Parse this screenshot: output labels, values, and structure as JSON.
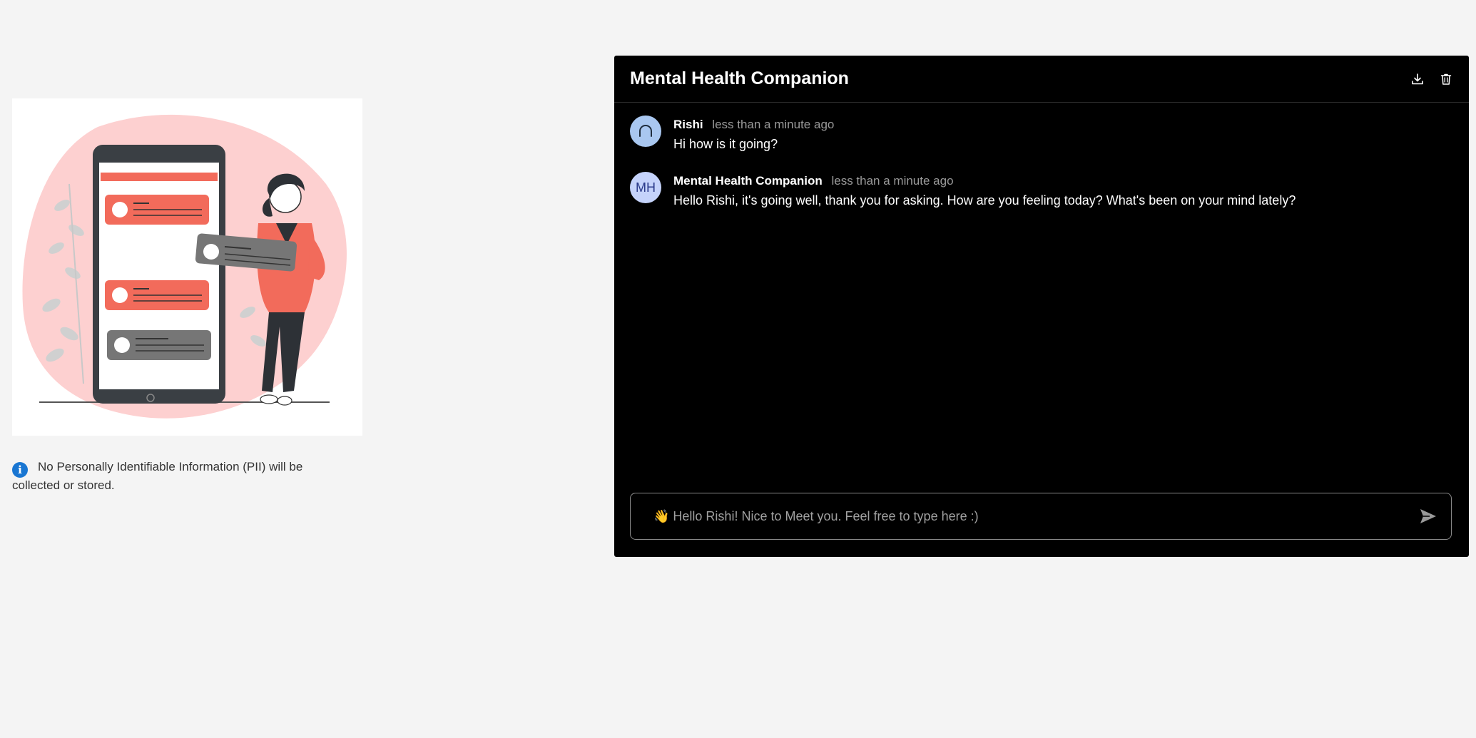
{
  "sidebar": {
    "pii_notice": "No Personally Identifiable Information (PII) will be collected or stored."
  },
  "chat": {
    "title": "Mental Health Companion",
    "actions": {
      "download": "download-icon",
      "delete": "trash-icon"
    },
    "messages": [
      {
        "sender": "Rishi",
        "time": "less than a minute ago",
        "text": "Hi how is it going?",
        "avatar_icon": "headphones-icon"
      },
      {
        "sender": "Mental Health Companion",
        "time": "less than a minute ago",
        "text": "Hello Rishi, it's going well, thank you for asking. How are you feeling today? What's been on your mind lately?",
        "avatar_initials": "MH"
      }
    ],
    "composer": {
      "placeholder": "👋 Hello Rishi! Nice to Meet you. Feel free to type here :)",
      "send_icon": "send-icon"
    }
  },
  "colors": {
    "page_bg": "#f4f4f4",
    "panel_bg": "#000000",
    "accent_coral": "#f26b5b",
    "blob_pink": "#fdd0d0",
    "info_blue": "#1976d2",
    "bot_avatar": "#c5d3fb",
    "user_avatar": "#a9c7f0"
  }
}
